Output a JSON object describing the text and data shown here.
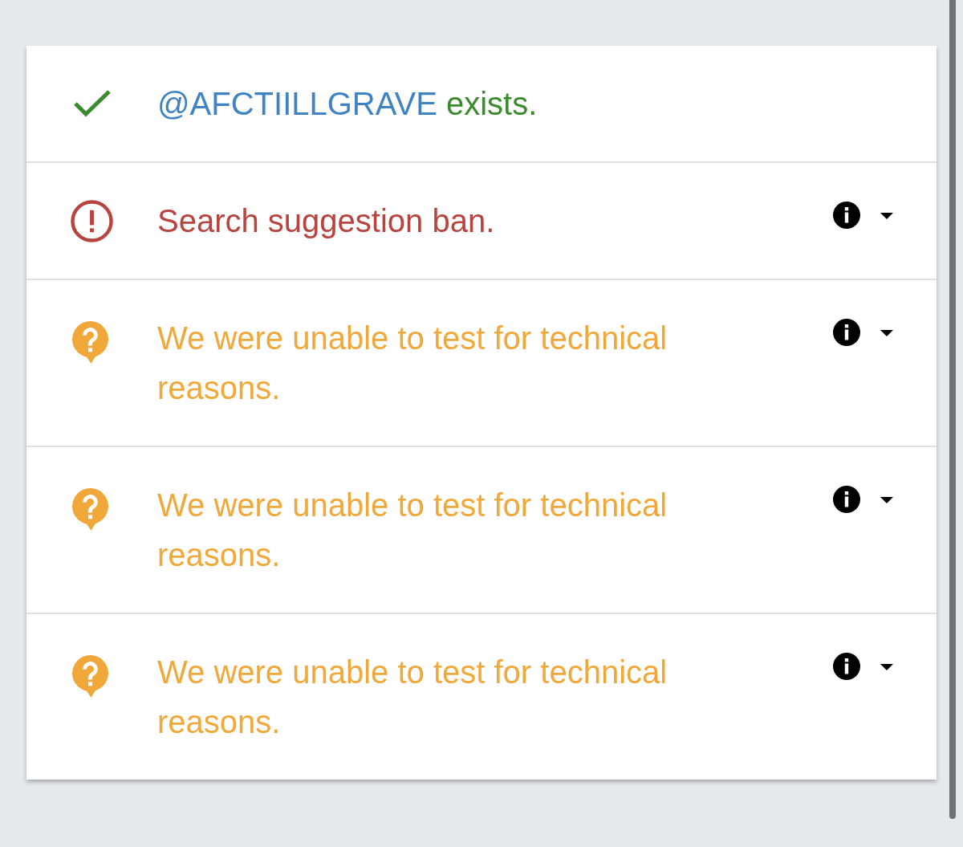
{
  "results": [
    {
      "kind": "ok",
      "handle": "@AFCTIILLGRAVE",
      "text": "exists."
    },
    {
      "kind": "ban",
      "text": "Search suggestion ban.",
      "expanded": false
    },
    {
      "kind": "unknown",
      "text": "We were unable to test for technical reasons.",
      "expanded": false
    },
    {
      "kind": "unknown",
      "text": "We were unable to test for technical reasons.",
      "expanded": false
    },
    {
      "kind": "unknown",
      "text": "We were unable to test for technical reasons.",
      "expanded": false
    }
  ]
}
